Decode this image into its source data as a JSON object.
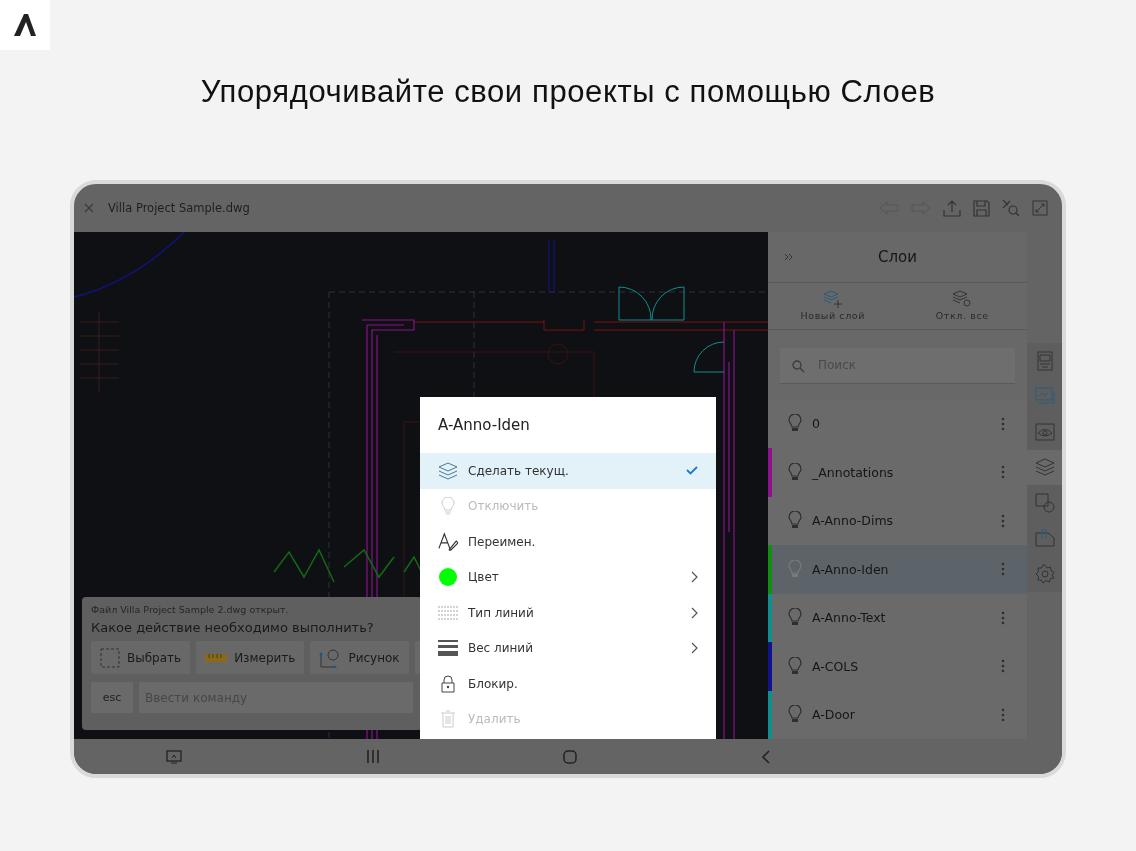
{
  "headline": "Упорядочивайте свои проекты с помощью Слоев",
  "app": {
    "title": "Villa Project Sample.dwg",
    "toolbar": [
      {
        "kind": "undo"
      },
      {
        "kind": "redo"
      },
      {
        "kind": "share"
      },
      {
        "kind": "save"
      },
      {
        "kind": "zoom"
      },
      {
        "kind": "fullscreen"
      }
    ],
    "command_bar": {
      "status": "Файл Villa Project Sample 2.dwg открыт.",
      "prompt": "Какое действие необходимо выполнить?",
      "tools": [
        {
          "kind": "select",
          "label": "Выбрать"
        },
        {
          "kind": "measure",
          "label": "Измерить"
        },
        {
          "kind": "draw",
          "label": "Рисунок"
        },
        {
          "kind": "annotate"
        }
      ],
      "esc": "esc",
      "input_placeholder": "Ввести команду"
    },
    "layer_menu": {
      "title": "A-Anno-Iden",
      "items": [
        {
          "kind": "current",
          "label": "Сделать текущ.",
          "selected": true,
          "disabled": false,
          "submenu": false
        },
        {
          "kind": "off",
          "label": "Отключить",
          "selected": false,
          "disabled": true,
          "submenu": false
        },
        {
          "kind": "rename",
          "label": "Переимен.",
          "selected": false,
          "disabled": false,
          "submenu": false
        },
        {
          "kind": "color",
          "label": "Цвет",
          "selected": false,
          "disabled": false,
          "submenu": true,
          "color": "#00ff00"
        },
        {
          "kind": "linetype",
          "label": "Тип линий",
          "selected": false,
          "disabled": false,
          "submenu": true
        },
        {
          "kind": "lineweight",
          "label": "Вес линий",
          "selected": false,
          "disabled": false,
          "submenu": true
        },
        {
          "kind": "lock",
          "label": "Блокир.",
          "selected": false,
          "disabled": false,
          "submenu": false
        },
        {
          "kind": "delete",
          "label": "Удалить",
          "selected": false,
          "disabled": true,
          "submenu": false
        }
      ]
    },
    "layers_panel": {
      "title": "Слои",
      "actions": [
        {
          "kind": "new",
          "label": "Новый слой"
        },
        {
          "kind": "off",
          "label": "Откл. все"
        }
      ],
      "search_placeholder": "Поиск",
      "layers": [
        {
          "name": "0",
          "selected": false
        },
        {
          "name": "_Annotations",
          "color": "#8e128e",
          "selected": false
        },
        {
          "name": "A-Anno-Dims",
          "selected": false
        },
        {
          "name": "A-Anno-Iden",
          "color": "#128e12",
          "selected": true
        },
        {
          "name": "A-Anno-Text",
          "color": "#128e8e",
          "selected": false
        },
        {
          "name": "A-COLS",
          "color": "#12128e",
          "selected": false
        },
        {
          "name": "A-Door",
          "color": "#128e8e",
          "selected": false
        }
      ]
    },
    "rail": [
      {
        "kind": "sheet",
        "selected": false
      },
      {
        "kind": "image",
        "selected": false
      },
      {
        "kind": "view",
        "selected": false
      },
      {
        "kind": "layers",
        "selected": true
      },
      {
        "kind": "shapes",
        "selected": false
      },
      {
        "kind": "attach",
        "selected": false
      },
      {
        "kind": "settings",
        "selected": false
      }
    ],
    "nav": [
      {
        "kind": "screenshot"
      },
      {
        "kind": "recents"
      },
      {
        "kind": "home"
      },
      {
        "kind": "back"
      }
    ]
  }
}
